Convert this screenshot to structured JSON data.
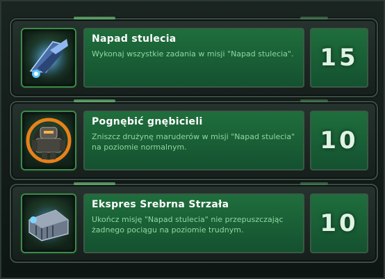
{
  "achievements": [
    {
      "title": "Napad stulecia",
      "description": "Wykonaj wszystkie zadania w misji \"Napad stulecia\".",
      "points": "15",
      "icon": "dropship-icon"
    },
    {
      "title": "Pognębić gnębicieli",
      "description": "Zniszcz drużynę maruderów w misji \"Napad stulecia\" na poziomie normalnym.",
      "points": "10",
      "icon": "marauder-icon"
    },
    {
      "title": "Ekspres Srebrna Strzała",
      "description": "Ukończ misję \"Napad stulecia\" nie przepuszczając żadnego pociągu na poziomie trudnym.",
      "points": "10",
      "icon": "train-icon"
    }
  ],
  "colors": {
    "panel_green": "#1f6e3c",
    "title_text": "#ffffff",
    "desc_text": "#8fd79f",
    "icon_border": "#3e8a4d"
  }
}
